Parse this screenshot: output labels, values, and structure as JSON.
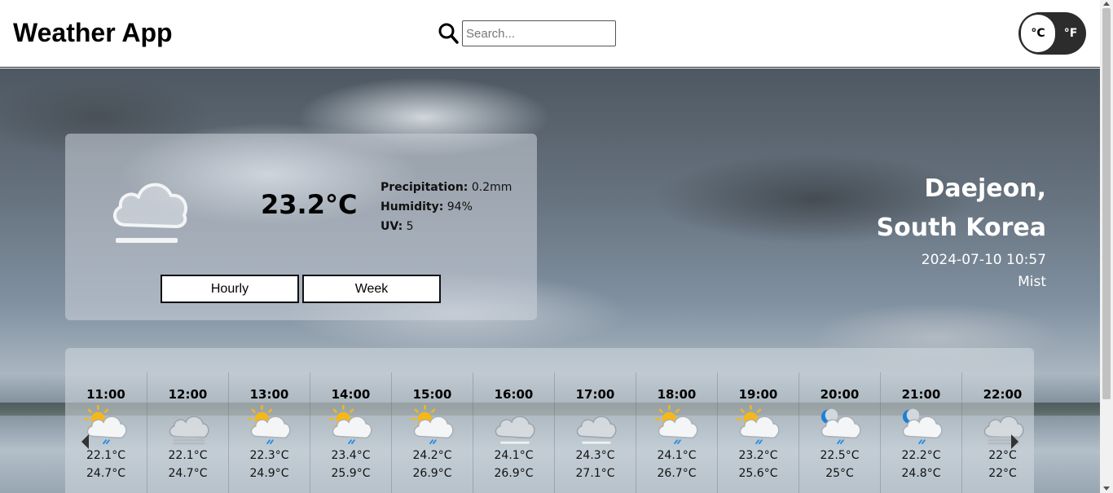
{
  "header": {
    "title": "Weather App",
    "search_placeholder": "Search...",
    "unit_celsius": "°C",
    "unit_fahrenheit": "°F",
    "active_unit": "C"
  },
  "current": {
    "icon": "mist-cloud-icon",
    "temperature": "23.2°C",
    "precipitation_label": "Precipitation:",
    "precipitation_value": "0.2mm",
    "humidity_label": "Humidity:",
    "humidity_value": "94%",
    "uv_label": "UV:",
    "uv_value": "5",
    "hourly_button": "Hourly",
    "week_button": "Week"
  },
  "location": {
    "city": "Daejeon,",
    "country": "South Korea",
    "datetime": "2024-07-10 10:57",
    "condition": "Mist"
  },
  "hourly": [
    {
      "time": "11:00",
      "icon": "sun-cloud-rain-icon",
      "temp1": "22.1°C",
      "temp2": "24.7°C"
    },
    {
      "time": "12:00",
      "icon": "mist-cloud-icon",
      "temp1": "22.1°C",
      "temp2": "24.7°C"
    },
    {
      "time": "13:00",
      "icon": "sun-cloud-rain-icon",
      "temp1": "22.3°C",
      "temp2": "24.9°C"
    },
    {
      "time": "14:00",
      "icon": "sun-cloud-rain-icon",
      "temp1": "23.4°C",
      "temp2": "25.9°C"
    },
    {
      "time": "15:00",
      "icon": "sun-cloud-rain-icon",
      "temp1": "24.2°C",
      "temp2": "26.9°C"
    },
    {
      "time": "16:00",
      "icon": "cloud-fog-icon",
      "temp1": "24.1°C",
      "temp2": "26.9°C"
    },
    {
      "time": "17:00",
      "icon": "cloud-fog-icon",
      "temp1": "24.3°C",
      "temp2": "27.1°C"
    },
    {
      "time": "18:00",
      "icon": "sun-cloud-rain-icon",
      "temp1": "24.1°C",
      "temp2": "26.7°C"
    },
    {
      "time": "19:00",
      "icon": "sun-cloud-rain-icon",
      "temp1": "23.2°C",
      "temp2": "25.6°C"
    },
    {
      "time": "20:00",
      "icon": "moon-cloud-rain-icon",
      "temp1": "22.5°C",
      "temp2": "25°C"
    },
    {
      "time": "21:00",
      "icon": "moon-cloud-rain-icon",
      "temp1": "22.2°C",
      "temp2": "24.8°C"
    },
    {
      "time": "22:00",
      "icon": "mist-cloud-icon",
      "temp1": "22°C",
      "temp2": "22°C"
    }
  ],
  "colors": {
    "sun": "#f5b818",
    "moon": "#1e7fd6",
    "rain": "#2a8ee0",
    "toggle_bg": "#2c2c2c"
  }
}
